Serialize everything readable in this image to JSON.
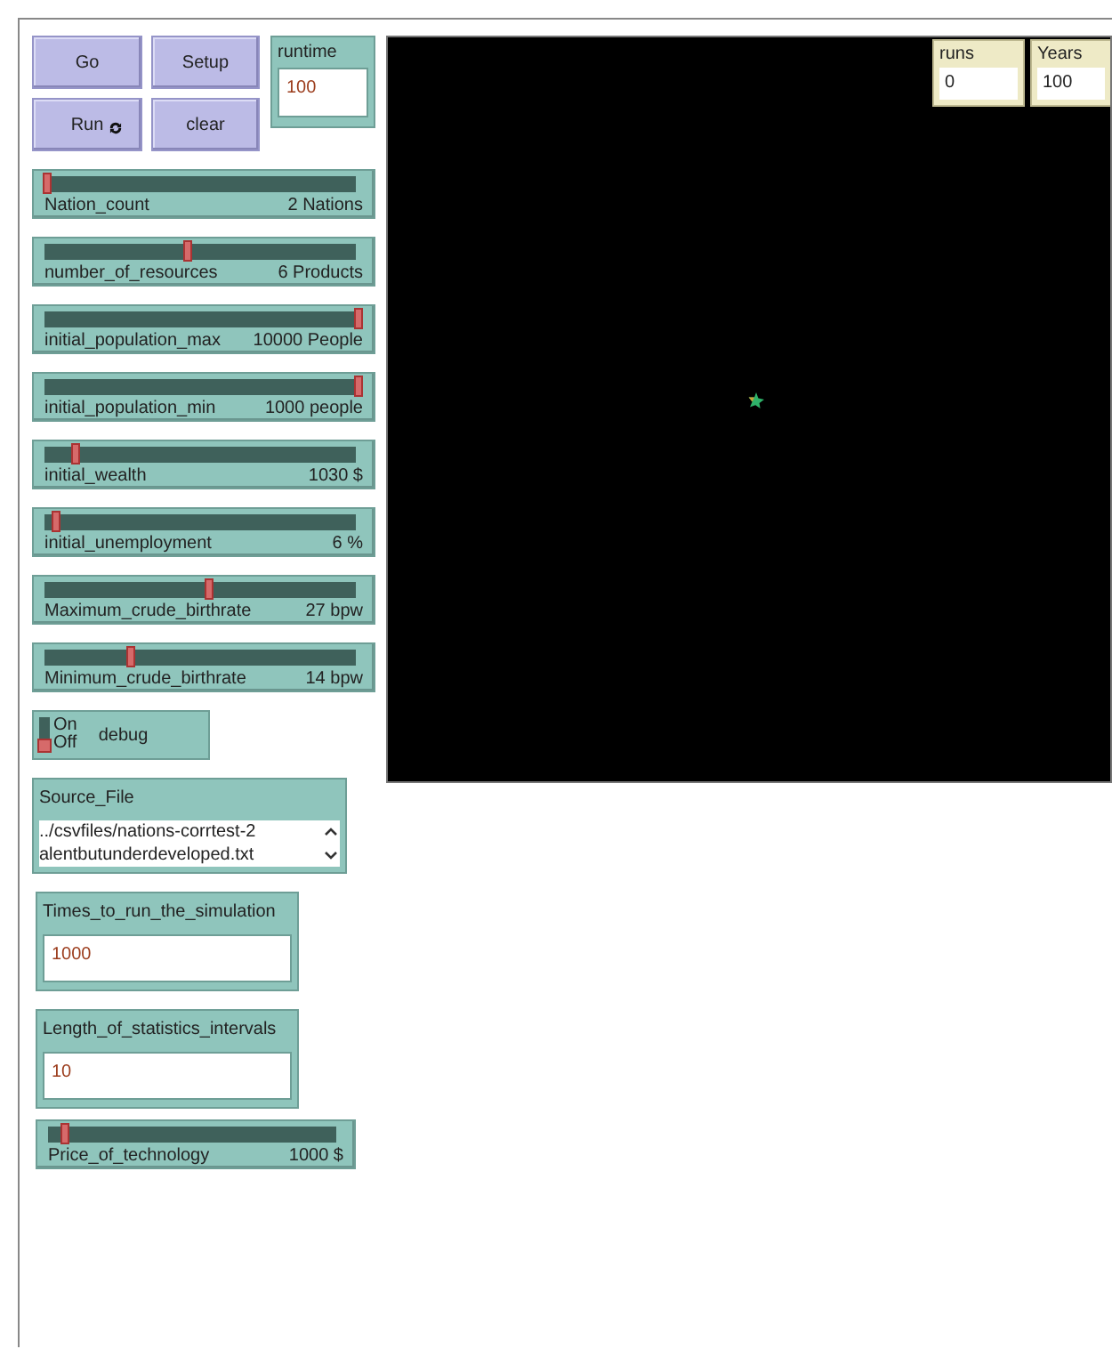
{
  "buttons": [
    {
      "label": "Go",
      "forever": false
    },
    {
      "label": "Setup",
      "forever": false
    },
    {
      "label": "Run",
      "forever": true
    },
    {
      "label": "clear",
      "forever": false
    }
  ],
  "runtime": {
    "label": "runtime",
    "value": "100"
  },
  "sliders": [
    {
      "name": "Nation_count",
      "reading": "2 Nations",
      "level": 0
    },
    {
      "name": "number_of_resources",
      "reading": "6 Products",
      "level": 0.45
    },
    {
      "name": "initial_population_max",
      "reading": "10000 People",
      "level": 1
    },
    {
      "name": "initial_population_min",
      "reading": "1000 people",
      "level": 1
    },
    {
      "name": "initial_wealth",
      "reading": "1030 $",
      "level": 0.09
    },
    {
      "name": "initial_unemployment",
      "reading": "6 %",
      "level": 0.03
    },
    {
      "name": "Maximum_crude_birthrate",
      "reading": "27 bpw",
      "level": 0.52
    },
    {
      "name": "Minimum_crude_birthrate",
      "reading": "14 bpw",
      "level": 0.27
    }
  ],
  "switch": {
    "on_label": "On",
    "off_label": "Off",
    "name": "debug",
    "on": false
  },
  "source_file": {
    "label": "Source_File",
    "lines": [
      "../csvfiles/nations-corrtest-2",
      "alentbutunderdeveloped.txt"
    ]
  },
  "inputs": [
    {
      "label": "Times_to_run_the_simulation",
      "value": "1000"
    },
    {
      "label": "Length_of_statistics_intervals",
      "value": "10"
    }
  ],
  "price_slider": {
    "name": "Price_of_technology",
    "reading": "1000 $",
    "level": 0.05
  },
  "monitors": [
    {
      "label": "runs",
      "value": "0"
    },
    {
      "label": "Years",
      "value": "100"
    }
  ]
}
